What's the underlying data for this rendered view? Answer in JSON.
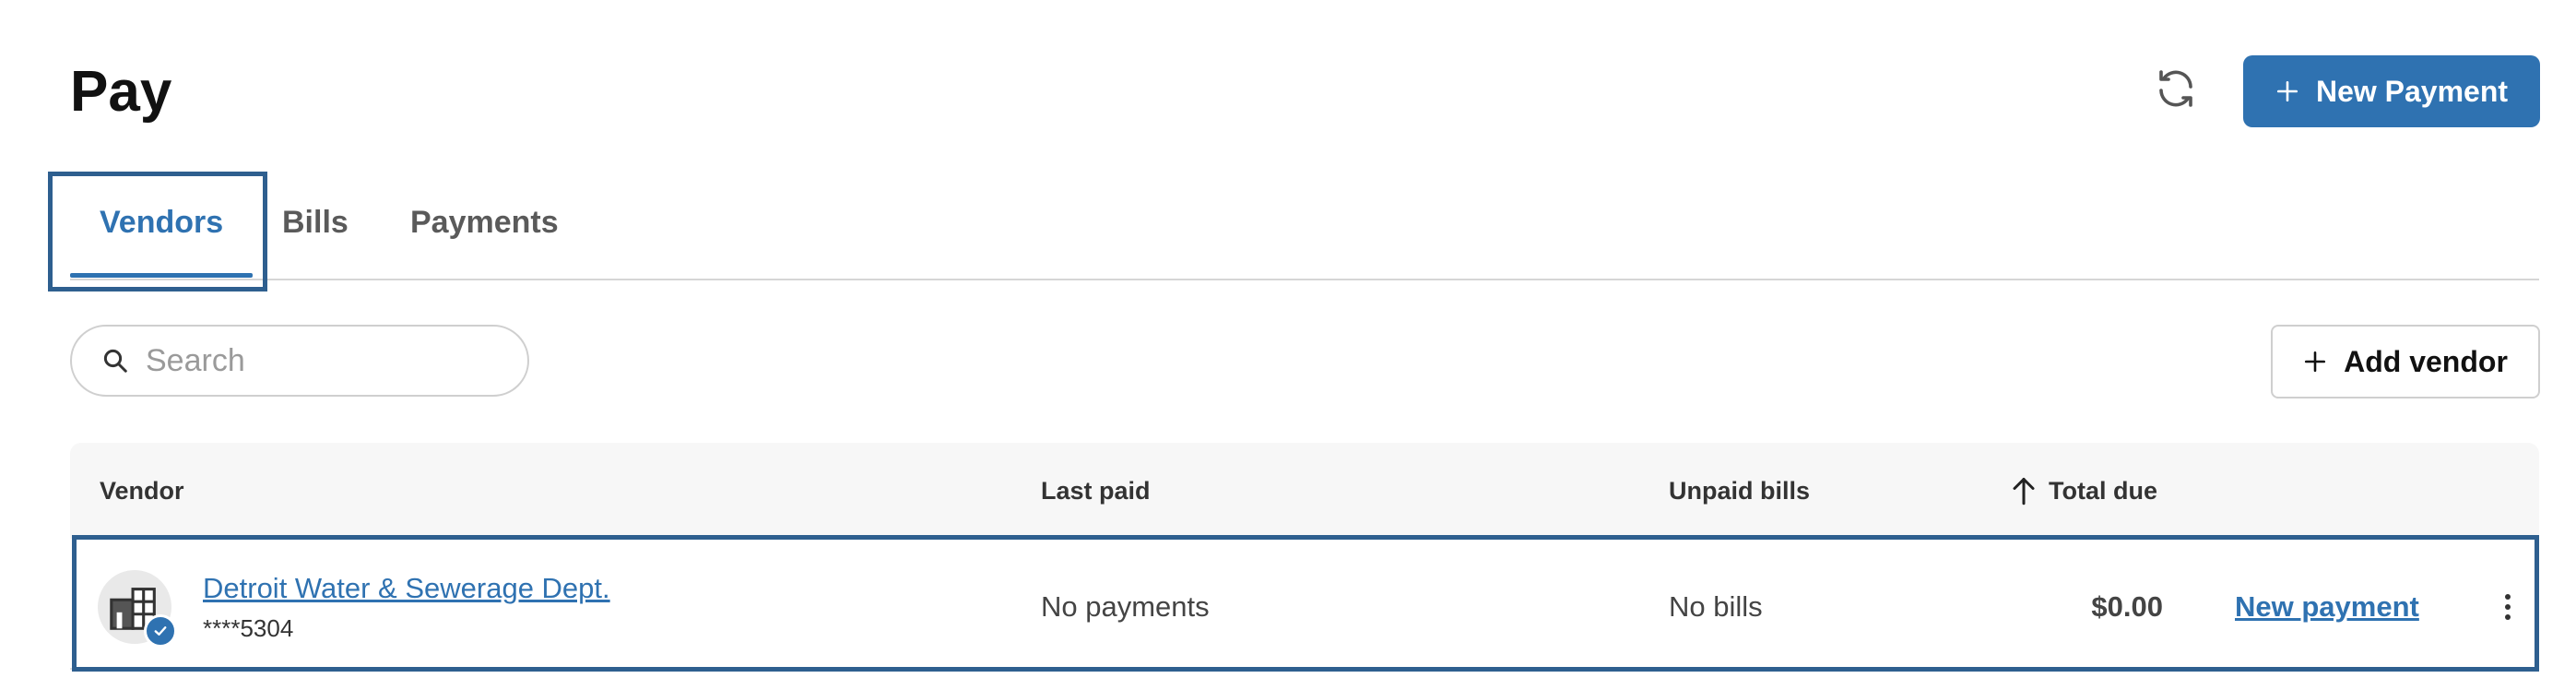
{
  "header": {
    "title": "Pay",
    "new_payment_label": "New Payment",
    "refresh_icon": "refresh-icon",
    "plus_icon": "plus-icon"
  },
  "tabs": [
    {
      "label": "Vendors",
      "active": true
    },
    {
      "label": "Bills",
      "active": false
    },
    {
      "label": "Payments",
      "active": false
    }
  ],
  "search": {
    "placeholder": "Search",
    "value": "",
    "icon": "search-icon"
  },
  "add_vendor_label": "Add vendor",
  "table": {
    "columns": {
      "vendor": "Vendor",
      "last_paid": "Last paid",
      "unpaid_bills": "Unpaid bills",
      "total_due": "Total due"
    },
    "sort_icon": "arrow-up-icon",
    "rows": [
      {
        "vendor_name": "Detroit Water & Sewerage Dept.",
        "account": "****5304",
        "last_paid": "No payments",
        "unpaid_bills": "No bills",
        "total_due": "$0.00",
        "action_label": "New payment",
        "avatar_icon": "building-icon",
        "badge_icon": "verified-check-icon",
        "menu_icon": "kebab-menu-icon"
      }
    ]
  },
  "colors": {
    "accent": "#2f72b1",
    "focus_outline": "#2e5f8f",
    "header_bg": "#f7f7f7"
  }
}
